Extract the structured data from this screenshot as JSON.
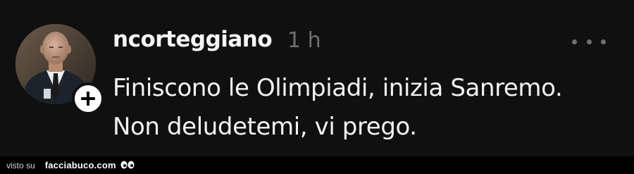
{
  "post": {
    "username": "ncorteggiano",
    "timestamp": "1 h",
    "text_lines": [
      "Finiscono le Olimpiadi, inizia Sanremo.",
      "Non deludetemi, vi prego."
    ],
    "avatar_icon": "user-avatar-photo",
    "follow_icon": "plus-icon",
    "more_icon": "more-horizontal-icon"
  },
  "footer": {
    "prefix": "visto su",
    "site": "facciabuco.com",
    "logo_icon": "eyes-logo-icon"
  },
  "colors": {
    "background": "#101010",
    "text": "#f2f2f2",
    "muted": "#6f6f6f",
    "footer_background": "#000000"
  }
}
